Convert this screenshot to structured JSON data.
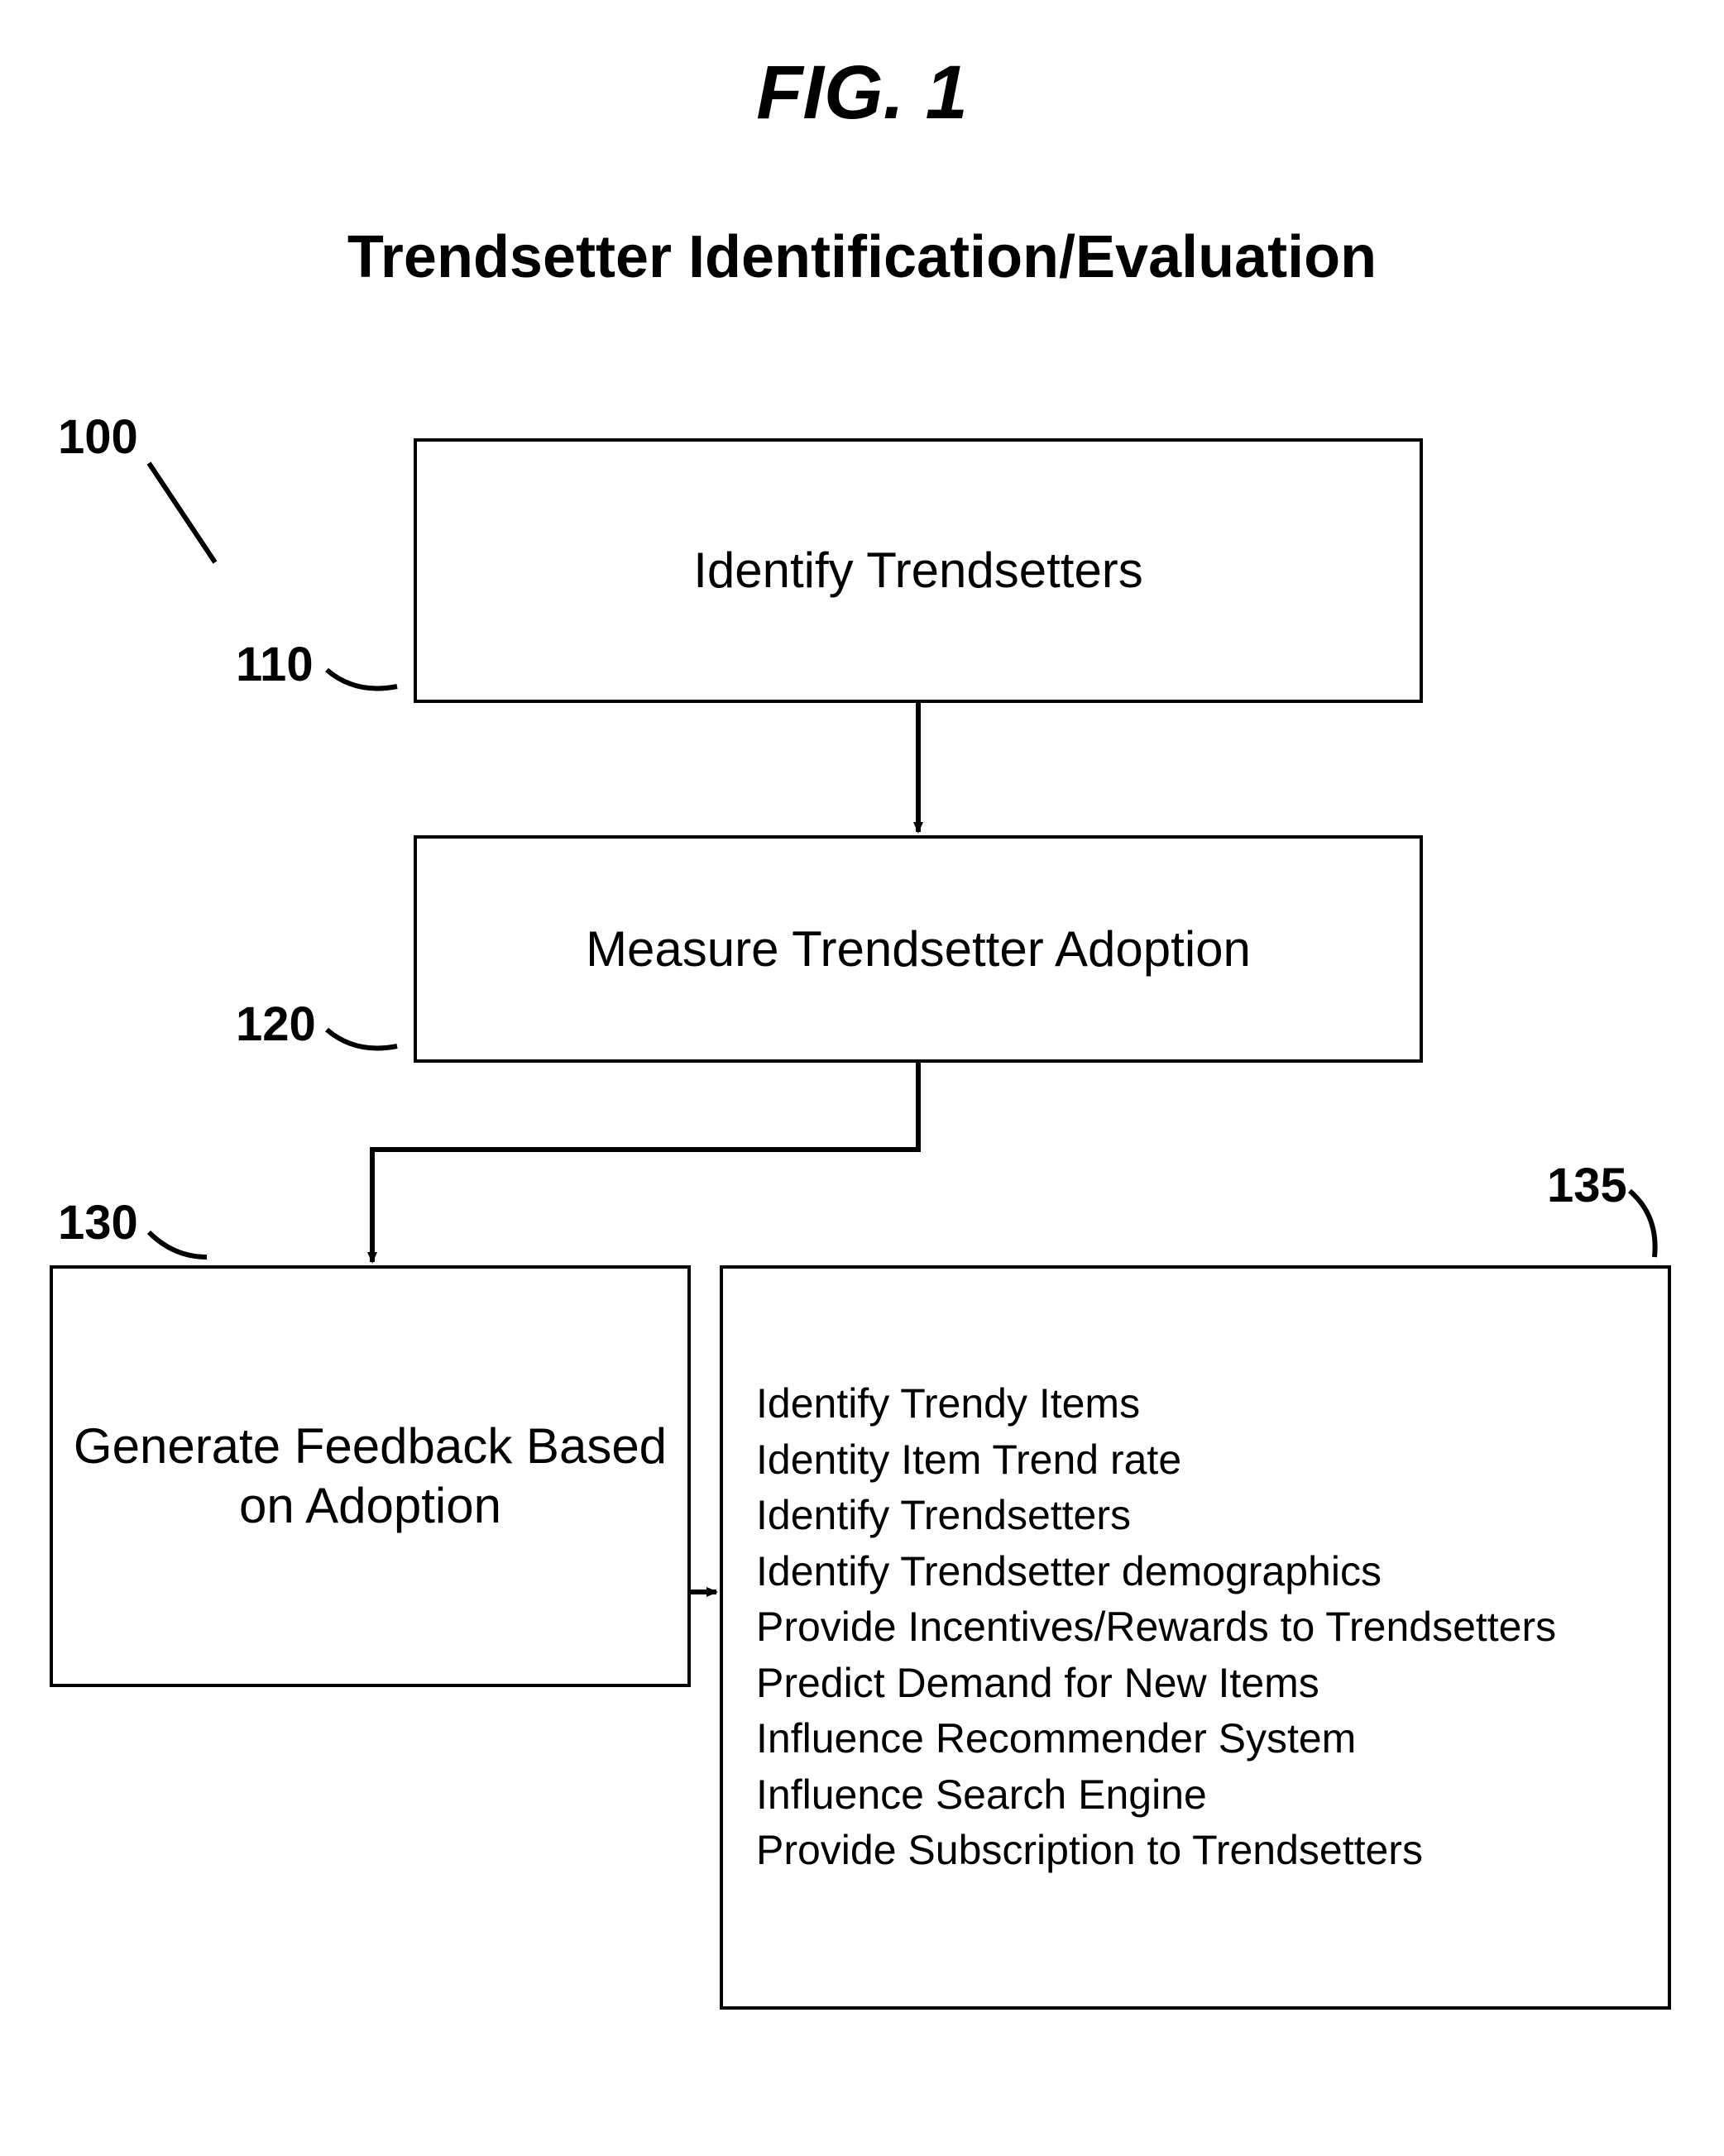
{
  "figure_title": "FIG. 1",
  "subtitle": "Trendsetter Identification/Evaluation",
  "labels": {
    "l100": "100",
    "l110": "110",
    "l120": "120",
    "l130": "130",
    "l135": "135"
  },
  "boxes": {
    "b110": "Identify Trendsetters",
    "b120": "Measure Trendsetter Adoption",
    "b130": "Generate Feedback Based on Adoption"
  },
  "b135_items": {
    "i0": "Identify Trendy Items",
    "i1": "Identity Item Trend rate",
    "i2": "Identify Trendsetters",
    "i3": "Identify Trendsetter demographics",
    "i4": "Provide Incentives/Rewards to Trendsetters",
    "i5": "Predict Demand for New Items",
    "i6": "Influence Recommender System",
    "i7": "Influence Search Engine",
    "i8": "Provide Subscription to Trendsetters"
  }
}
